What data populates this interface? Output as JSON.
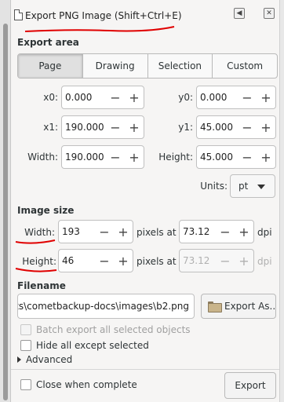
{
  "dialog": {
    "title": "Export PNG Image (Shift+Ctrl+E)",
    "title_buttons": [
      "◀",
      "✕"
    ]
  },
  "export_area": {
    "label": "Export area",
    "modes": [
      {
        "label": "Page",
        "active": true
      },
      {
        "label": "Drawing",
        "active": false
      },
      {
        "label": "Selection",
        "active": false
      },
      {
        "label": "Custom",
        "active": false
      }
    ],
    "x0": {
      "label": "x0:",
      "value": "0.000"
    },
    "y0": {
      "label": "y0:",
      "value": "0.000"
    },
    "x1": {
      "label": "x1:",
      "value": "190.000"
    },
    "y1": {
      "label": "y1:",
      "value": "45.000"
    },
    "width": {
      "label": "Width:",
      "value": "190.000"
    },
    "height": {
      "label": "Height:",
      "value": "45.000"
    },
    "units_label": "Units:",
    "units_value": "pt"
  },
  "image_size": {
    "label": "Image size",
    "width": {
      "label": "Width:",
      "value": "193",
      "pixels_at": "pixels at",
      "dpi_value": "73.12",
      "dpi_unit": "dpi"
    },
    "height": {
      "label": "Height:",
      "value": "46",
      "pixels_at": "pixels at",
      "dpi_value": "73.12",
      "dpi_unit": "dpi"
    }
  },
  "filename": {
    "label": "Filename",
    "value": "ents\\cometbackup-docs\\images\\b2.png",
    "export_as_label": "Export As..."
  },
  "options": {
    "batch_export": "Batch export all selected objects",
    "hide_all_except": "Hide all except selected",
    "advanced": "Advanced",
    "close_when_complete": "Close when complete"
  },
  "footer": {
    "export_label": "Export"
  },
  "annotation_color": "#e00000",
  "icons": {
    "doc": "document-icon",
    "plus": "+",
    "minus": "−"
  }
}
